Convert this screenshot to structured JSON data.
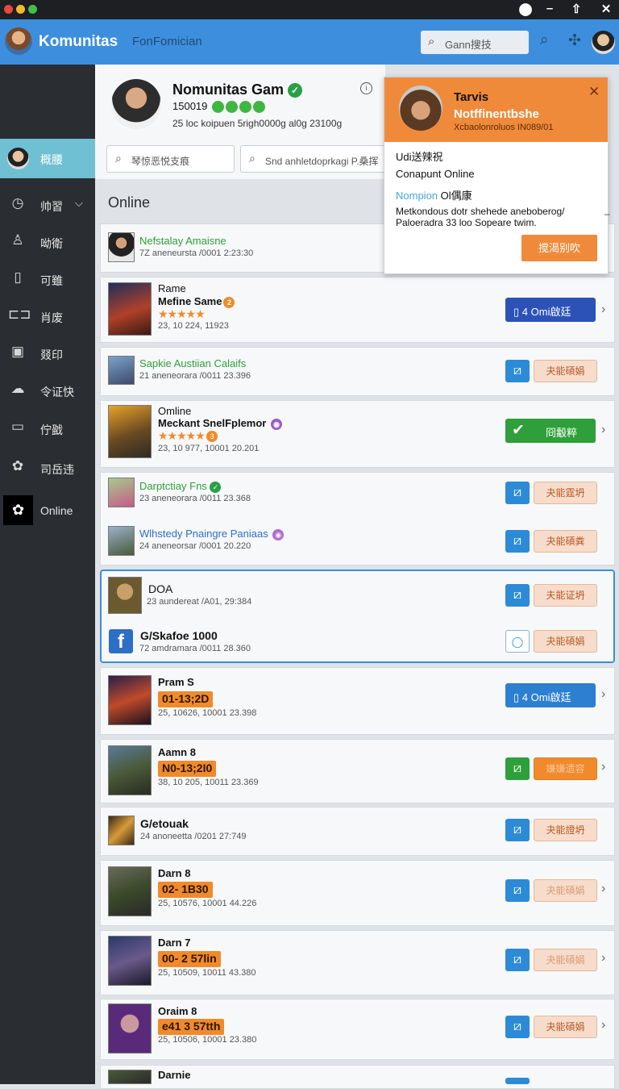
{
  "header": {
    "app_name": "Komunitas",
    "subtitle": "FonFomician",
    "search_placeholder": "Gann搜技"
  },
  "sidebar": {
    "top": "概腰",
    "items": [
      {
        "label": "帅習",
        "icon": "clock-icon"
      },
      {
        "label": "呦衛",
        "icon": "user-icon"
      },
      {
        "label": "可雖",
        "icon": "tablet-icon"
      },
      {
        "label": "肖废",
        "icon": "gamepad-icon"
      },
      {
        "label": "叕印",
        "icon": "image-icon"
      },
      {
        "label": "令证快",
        "icon": "cloud-icon"
      },
      {
        "label": "佇戤",
        "icon": "screen-icon"
      },
      {
        "label": "司岳违",
        "icon": "gear-icon"
      },
      {
        "label": "Online",
        "icon": "cog-icon"
      }
    ]
  },
  "profile": {
    "name": "Nomunitas Gam",
    "id": "150019",
    "stats": "25 loc koipuen 5righ0000g al0g 23100g"
  },
  "filters": {
    "filter1": "琴惊恶悦支痕",
    "filter2": "Snd anhletdoprkagi P.桑挥"
  },
  "section_title": "Online",
  "rows": [
    {
      "name": "Nefstalay Amaisne",
      "meta": "7Z aneneursta /0001 2:23:30"
    },
    {
      "line1": "Rame",
      "name": "Mefine Same",
      "badge": "2",
      "meta": "23, 10 224, 11923",
      "action": "4 Omi啟廷"
    },
    {
      "name": "Sapkie Austiian Calaifs",
      "meta": "21 aneneorara /0011 23.396",
      "action": "夬能碩娟"
    },
    {
      "line1": "Omline",
      "name": "Meckant SnelFplemor",
      "badge": "3",
      "meta": "23, 10 977, 10001 20.201",
      "action": "冏觳粹"
    },
    {
      "name": "Darptctiay Fns",
      "meta": "23 aneneorara /0011 23.368",
      "action": "夬能霆坍"
    },
    {
      "name": "Wlhstedy Pnaingre Paniaas",
      "meta": "24 aneneorsar /0001 20.220",
      "action": "夬能碩粪"
    },
    {
      "name": "DOA",
      "meta": "23 aundereat /A01, 29:384",
      "action": "夫能证坍"
    },
    {
      "name": "G/Skafoe 1000",
      "meta": "72 amdramara /0011 28.360",
      "action": "夬能碩娟"
    },
    {
      "name": "Pram S",
      "tag": "01-13;2D",
      "meta": "25, 10626, 10001 23.398",
      "action": "4 Omi啟廷"
    },
    {
      "name": "Aamn 8",
      "tag": "N0-13;2I0",
      "meta": "38, 10 205, 10011 23.369",
      "action": "嫌嫌遗容"
    },
    {
      "name": "G/etouak",
      "meta": "24 anoneetta /0201 27:749",
      "action": "夬能證坍"
    },
    {
      "name": "Darn 8",
      "tag": "02- 1B30",
      "meta": "25, 10576, 10001 44.226",
      "action": "夬能碩娟"
    },
    {
      "name": "Darn 7",
      "tag": "00- 2 57lin",
      "meta": "25, 10509, 10011 43.380",
      "action": "夬能碩娟"
    },
    {
      "name": "Oraim 8",
      "tag": "e41 3 57tth",
      "meta": "25, 10506, 10001 23.380",
      "action": "夬能碩娟"
    },
    {
      "name": "Darnie"
    }
  ],
  "popup": {
    "name": "Tarvis",
    "title": "Notffinentbshe",
    "subtitle": "Xcbaolonroluos IN089/01",
    "line1": "Udi送辣祝",
    "line2": "Conapunt Online",
    "line3_a": "Nompion",
    "line3_b": "Ol偶康",
    "desc1": "Metkondous dotr shehede aneboberog/",
    "desc2": "Paloeradra 33 loo Sopeare twim.",
    "button": "搅渴别吹"
  },
  "colors": {
    "accent": "#3d8fde",
    "sidebar": "#2a2d31",
    "orange": "#f08a2b",
    "green": "#2e9f3a"
  }
}
